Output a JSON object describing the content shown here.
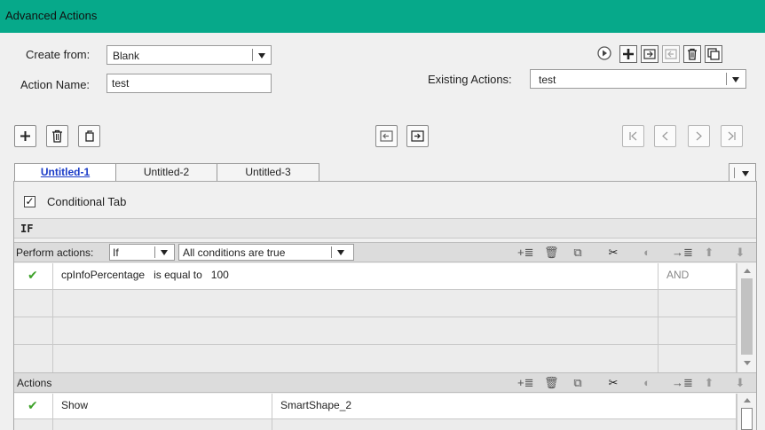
{
  "window": {
    "title": "Advanced Actions"
  },
  "form": {
    "create_from_label": "Create from:",
    "create_from_value": "Blank",
    "action_name_label": "Action Name:",
    "action_name_value": "test",
    "existing_actions_label": "Existing Actions:",
    "existing_actions_value": "test"
  },
  "top_icons": [
    "play-icon",
    "add-icon",
    "import-icon",
    "export-icon",
    "delete-icon",
    "duplicate-icon"
  ],
  "left_toolbar": {
    "add": "+",
    "delete": "🗑",
    "duplicate": "⧉"
  },
  "nav_buttons": [
    "first",
    "previous",
    "next",
    "last"
  ],
  "tabs": [
    {
      "label": "Untitled-1",
      "active": true
    },
    {
      "label": "Untitled-2",
      "active": false
    },
    {
      "label": "Untitled-3",
      "active": false
    }
  ],
  "conditional_tab": {
    "label": "Conditional Tab",
    "checked": true,
    "check": "✓"
  },
  "if_label": "IF",
  "perform": {
    "label": "Perform actions:",
    "mode_value": "If",
    "condition_value": "All conditions are true"
  },
  "conditions": [
    {
      "check": "✔",
      "text": "cpInfoPercentage   is equal to   100",
      "op": "AND"
    },
    {
      "check": "",
      "text": "",
      "op": ""
    },
    {
      "check": "",
      "text": "",
      "op": ""
    },
    {
      "check": "",
      "text": "",
      "op": ""
    }
  ],
  "actions_label": "Actions",
  "actions": [
    {
      "check": "✔",
      "action": "Show",
      "target": "SmartShape_2"
    }
  ],
  "toolbar_icons": {
    "add": "+≣",
    "delete": "🗑",
    "copy": "⧉",
    "cut": "✂",
    "paste": "◐",
    "insert": "→≣",
    "up": "⬆",
    "down": "⬇"
  }
}
